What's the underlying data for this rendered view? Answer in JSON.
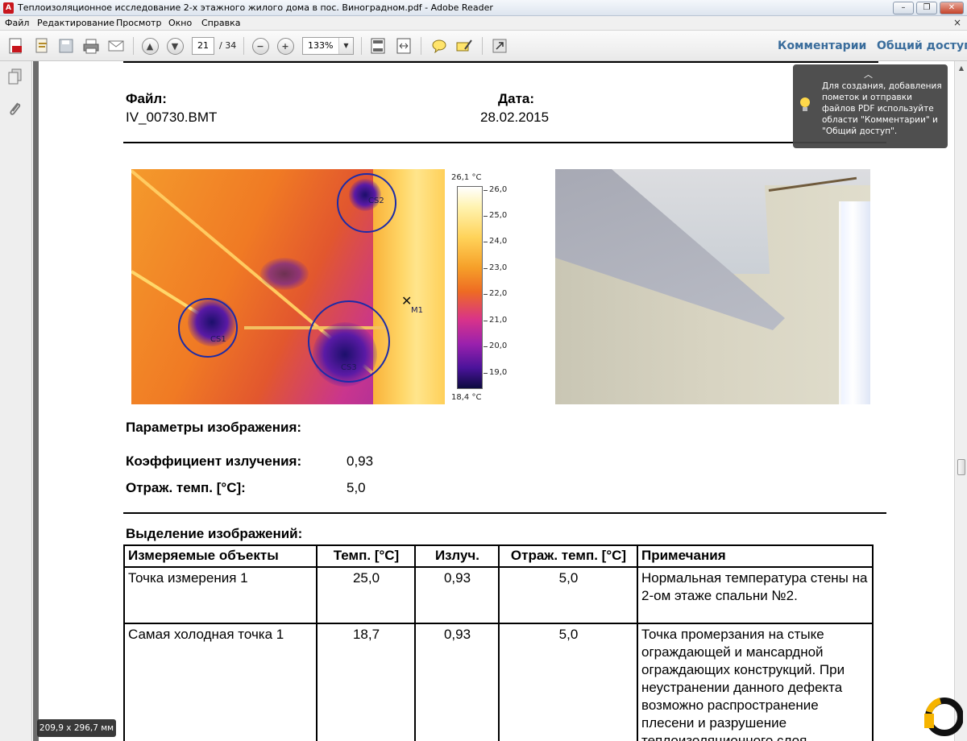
{
  "window": {
    "title": "Теплоизоляционное исследование 2-х этажного жилого дома в пос. Виноградном.pdf - Adobe Reader",
    "minimize": "–",
    "restore": "❐",
    "close": "✕"
  },
  "menu": {
    "items": [
      "Файл",
      "Редактирование",
      "Просмотр",
      "Окно",
      "Справка"
    ],
    "close": "×"
  },
  "toolbar": {
    "page_current": "21",
    "page_total": "/ 34",
    "zoom": "133%",
    "zoom_arrow": "▼",
    "comments": "Комментарии",
    "share": "Общий доступ"
  },
  "doc": {
    "file_label": "Файл:",
    "file_value": "IV_00730.BMT",
    "date_label": "Дата:",
    "date_value": "28.02.2015",
    "params_title": "Параметры изображения:",
    "emissivity_label": "Коэффициент излучения:",
    "emissivity_value": "0,93",
    "refl_label": "Отраж. темп. [°C]:",
    "refl_value": "5,0",
    "selection_title": "Выделение изображений:"
  },
  "thermal": {
    "scale_max": "26,1 °C",
    "scale_min": "18,4 °C",
    "ticks": [
      "26,0",
      "25,0",
      "24,0",
      "23,0",
      "22,0",
      "21,0",
      "20,0",
      "19,0"
    ],
    "markers": [
      "CS2",
      "CS1",
      "CS3",
      "M1"
    ]
  },
  "table": {
    "headers": [
      "Измеряемые объекты",
      "Темп. [°C]",
      "Излуч.",
      "Отраж. темп. [°C]",
      "Примечания"
    ],
    "rows": [
      {
        "object": "Точка измерения 1",
        "temp": "25,0",
        "emis": "0,93",
        "refl": "5,0",
        "note": "Нормальная температура стены на 2-ом этаже спальни №2."
      },
      {
        "object": "Самая холодная точка 1",
        "temp": "18,7",
        "emis": "0,93",
        "refl": "5,0",
        "note": "Точка промерзания на стыке ограждающей и мансардной ограждающих конструкций. При неустранении данного дефекта возможно распространение плесени и разрушение теплоизоляционного слоя"
      }
    ]
  },
  "tooltip": {
    "text": "Для создания, добавления пометок и отправки файлов PDF используйте области \"Комментарии\" и \"Общий доступ\"."
  },
  "size_badge": "209,9 x 296,7 мм"
}
